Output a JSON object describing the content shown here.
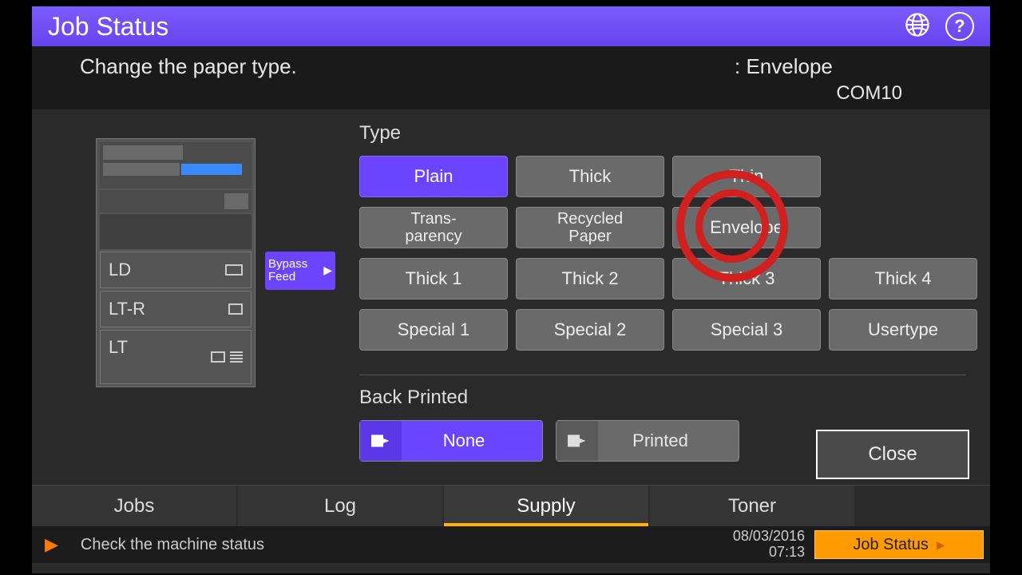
{
  "header": {
    "title": "Job Status"
  },
  "subheader": {
    "instruction": "Change the paper type.",
    "current_label": ": Envelope",
    "size": "COM10"
  },
  "trays": {
    "bypass_label": "Bypass Feed",
    "rows": [
      {
        "label": "LD"
      },
      {
        "label": "LT-R"
      },
      {
        "label": "LT"
      }
    ]
  },
  "type_section": {
    "label": "Type",
    "buttons": [
      "Plain",
      "Thick",
      "Thin",
      "",
      "Trans-\nparency",
      "Recycled\nPaper",
      "Envelope",
      "",
      "Thick 1",
      "Thick 2",
      "Thick 3",
      "Thick 4",
      "Special 1",
      "Special 2",
      "Special 3",
      "Usertype"
    ],
    "selected": "Plain",
    "highlighted": "Envelope"
  },
  "back_printed": {
    "label": "Back Printed",
    "none": "None",
    "printed": "Printed",
    "selected": "None"
  },
  "close_label": "Close",
  "tabs": {
    "items": [
      "Jobs",
      "Log",
      "Supply",
      "Toner"
    ],
    "active": "Supply"
  },
  "footer": {
    "message": "Check the machine status",
    "date": "08/03/2016",
    "time": "07:13",
    "job_status_btn": "Job Status"
  }
}
